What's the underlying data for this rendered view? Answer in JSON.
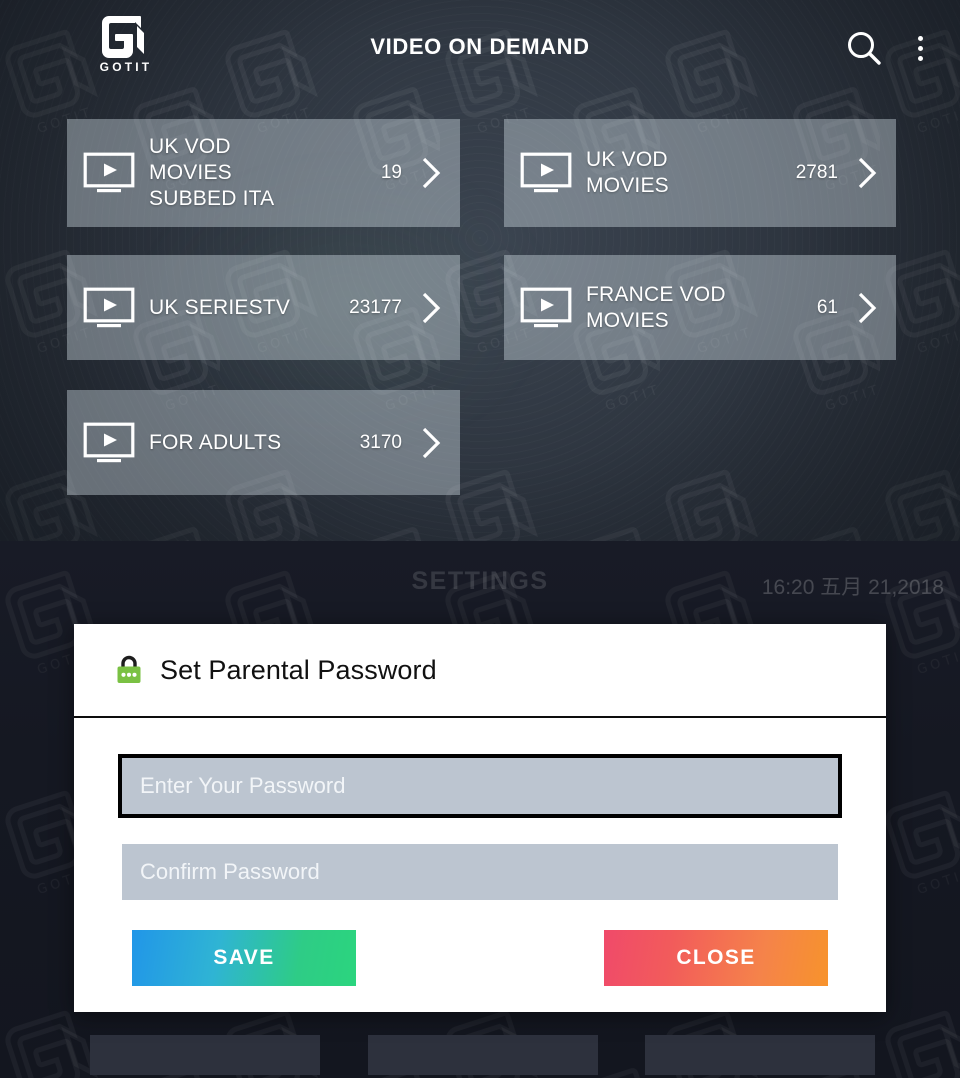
{
  "vod": {
    "logo": {
      "mark_name": "gotit-logo",
      "wordmark": "GOTIT"
    },
    "header": {
      "title": "VIDEO ON DEMAND",
      "search_icon": "search-icon",
      "overflow_icon": "more-vertical-icon"
    },
    "cards": [
      {
        "label": "UK VOD\nMOVIES\nSUBBED ITA",
        "count": "19",
        "icon": "tv-play-icon",
        "chevron": "chevron-right-icon"
      },
      {
        "label": "UK VOD\nMOVIES",
        "count": "2781",
        "icon": "tv-play-icon",
        "chevron": "chevron-right-icon"
      },
      {
        "label": "UK SERIESTV",
        "count": "23177",
        "icon": "tv-play-icon",
        "chevron": "chevron-right-icon"
      },
      {
        "label": "FRANCE VOD\nMOVIES",
        "count": "61",
        "icon": "tv-play-icon",
        "chevron": "chevron-right-icon"
      },
      {
        "label": "FOR ADULTS",
        "count": "3170",
        "icon": "tv-play-icon",
        "chevron": "chevron-right-icon"
      }
    ]
  },
  "settings": {
    "title": "SETTINGS",
    "clock": "16:20 五月 21,2018"
  },
  "dialog": {
    "title": "Set Parental Password",
    "lock_icon": "lock-icon",
    "fields": [
      {
        "placeholder": "Enter Your Password",
        "value": "",
        "name": "password-input"
      },
      {
        "placeholder": "Confirm Password",
        "value": "",
        "name": "confirm-password-input"
      }
    ],
    "save_label": "SAVE",
    "close_label": "CLOSE"
  },
  "colors": {
    "lock_green": "#7ac143",
    "save_from": "#2196e8",
    "save_to": "#2bd57e",
    "close_from": "#f04a6a",
    "close_to": "#f7932c",
    "card_fill": "rgba(216,227,235,0.40)",
    "dialog_bg": "#ffffff",
    "field_bg": "#bcc5d0"
  }
}
